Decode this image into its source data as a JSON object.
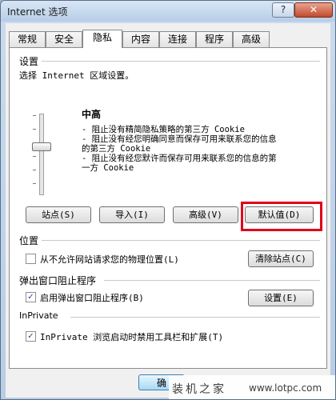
{
  "window": {
    "title": "Internet 选项",
    "help_label": "?",
    "close_label": "✕"
  },
  "tabs": [
    {
      "label": "常规"
    },
    {
      "label": "安全"
    },
    {
      "label": "隐私"
    },
    {
      "label": "内容"
    },
    {
      "label": "连接"
    },
    {
      "label": "程序"
    },
    {
      "label": "高级"
    }
  ],
  "active_tab": "隐私",
  "settings": {
    "heading": "设置",
    "instruction": "选择 Internet 区域设置。",
    "level": "中高",
    "slider_level": "中高",
    "desc_lines": [
      "- 阻止没有精简隐私策略的第三方 Cookie",
      "- 阻止没有经您明确同意而保存可用来联系您的信息",
      "的第三方 Cookie",
      "- 阻止没有经您默许而保存可用来联系您的信息的第",
      "一方 Cookie"
    ],
    "buttons": {
      "sites": "站点(S)",
      "import": "导入(I)",
      "advanced": "高级(V)",
      "default": "默认值(D)"
    }
  },
  "location": {
    "heading": "位置",
    "checkbox_label": "从不允许网站请求您的物理位置(L)",
    "checked": false,
    "clear_button": "清除站点(C)"
  },
  "popup": {
    "heading": "弹出窗口阻止程序",
    "checkbox_label": "启用弹出窗口阻止程序(B)",
    "checked": true,
    "settings_button": "设置(E)"
  },
  "inprivate": {
    "heading": "InPrivate",
    "checkbox_label": "InPrivate 浏览启动时禁用工具栏和扩展(T)",
    "checked": true
  },
  "footer": {
    "ok_label": "确"
  },
  "watermark": {
    "cn": "装机之家",
    "url": "www.lotpc.com"
  },
  "colors": {
    "highlight": "#e0001b",
    "accent": "#3c7fb1"
  }
}
